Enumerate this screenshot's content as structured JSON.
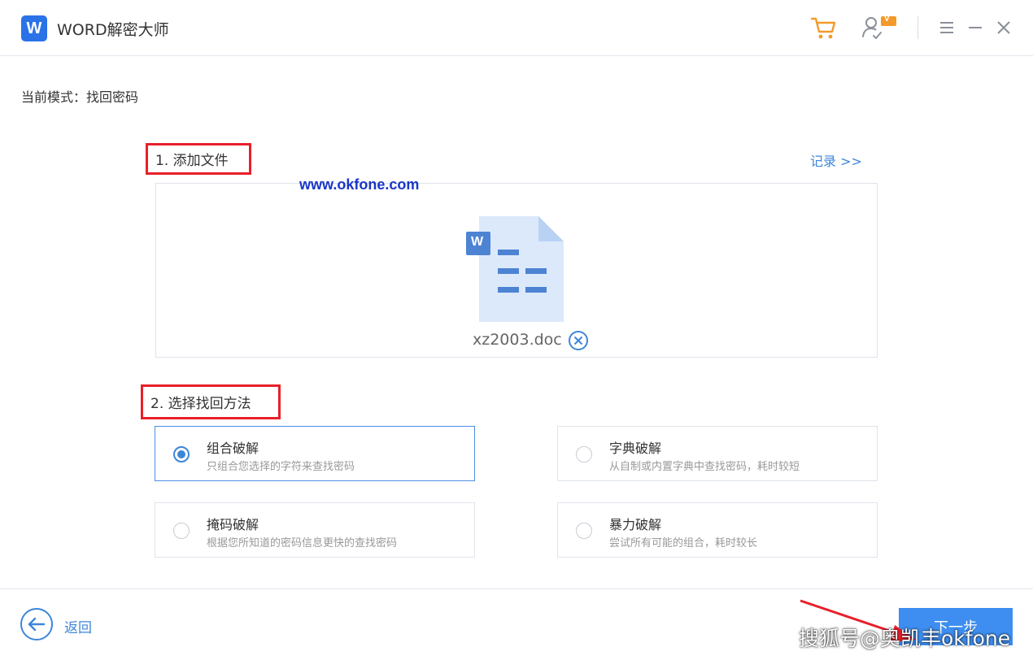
{
  "app": {
    "logo_letter": "W",
    "title": "WORD解密大师",
    "user_badge": "V"
  },
  "mode": {
    "text": "当前模式：找回密码"
  },
  "step1": {
    "heading": "1. 添加文件",
    "records_link": "记录 >>",
    "file_badge": "W",
    "file_name": "xz2003.doc"
  },
  "watermark_url": "www.okfone.com",
  "step2": {
    "heading": "2. 选择找回方法",
    "options": [
      {
        "title": "组合破解",
        "desc": "只组合您选择的字符来查找密码",
        "selected": true
      },
      {
        "title": "字典破解",
        "desc": "从自制或内置字典中查找密码，耗时较短",
        "selected": false
      },
      {
        "title": "掩码破解",
        "desc": "根据您所知道的密码信息更快的查找密码",
        "selected": false
      },
      {
        "title": "暴力破解",
        "desc": "尝试所有可能的组合，耗时较长",
        "selected": false
      }
    ]
  },
  "footer": {
    "back_label": "返回",
    "next_label": "下一步"
  },
  "corner_watermark": "搜狐号@奥凯丰okfone",
  "colors": {
    "accent": "#3d86d8",
    "primary_button": "#3d8ef0",
    "annotation_red": "#e8202a",
    "watermark_blue": "#1936c8",
    "cart_orange": "#f39a2b"
  },
  "icons": [
    "shopping-cart-icon",
    "user-icon",
    "menu-icon",
    "minimize-icon",
    "close-icon",
    "word-document-icon",
    "remove-circle-icon",
    "back-arrow-icon"
  ]
}
